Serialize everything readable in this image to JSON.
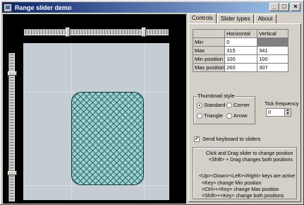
{
  "window": {
    "title": "Range slider demo",
    "buttons": [
      "_",
      "□",
      "×"
    ]
  },
  "tabs": [
    {
      "label": "Controls",
      "active": true
    },
    {
      "label": "Slider types",
      "active": false
    },
    {
      "label": "About",
      "active": false
    }
  ],
  "grid": {
    "headers": [
      "",
      "Horizontal",
      "Vertical"
    ],
    "rows": [
      {
        "label": "Min",
        "h": "0",
        "v": "0"
      },
      {
        "label": "Max",
        "h": "315",
        "v": "341"
      },
      {
        "label": "Min position",
        "h": "100",
        "v": "100"
      },
      {
        "label": "Max position",
        "h": "260",
        "v": "307"
      }
    ]
  },
  "thumbnail_style": {
    "legend": "Thumbnail style",
    "options": [
      {
        "label": "Standard",
        "selected": true
      },
      {
        "label": "Corner",
        "selected": false
      },
      {
        "label": "Triangle",
        "selected": false
      },
      {
        "label": "Arrow",
        "selected": false
      }
    ]
  },
  "tick_frequency": {
    "label": "Tick frequency",
    "value": "0"
  },
  "send_keyboard": {
    "label": "Send keyboard to sliders",
    "checked": true
  },
  "help": [
    "Click and Drag slider to change position",
    "<Shift> + Drag changes both positions",
    "<Up><Down><Left><Right> keys are active",
    "<Key> change Min position",
    "<Ctrl>+<Key> change Max position",
    "<Shift>+<Key> change both positions"
  ],
  "colors": {
    "title_gradient_start": "#0a246a",
    "title_gradient_end": "#a6caf0",
    "canvas": "#c6ccd4",
    "hatch_fill": "#9fd0d0"
  }
}
